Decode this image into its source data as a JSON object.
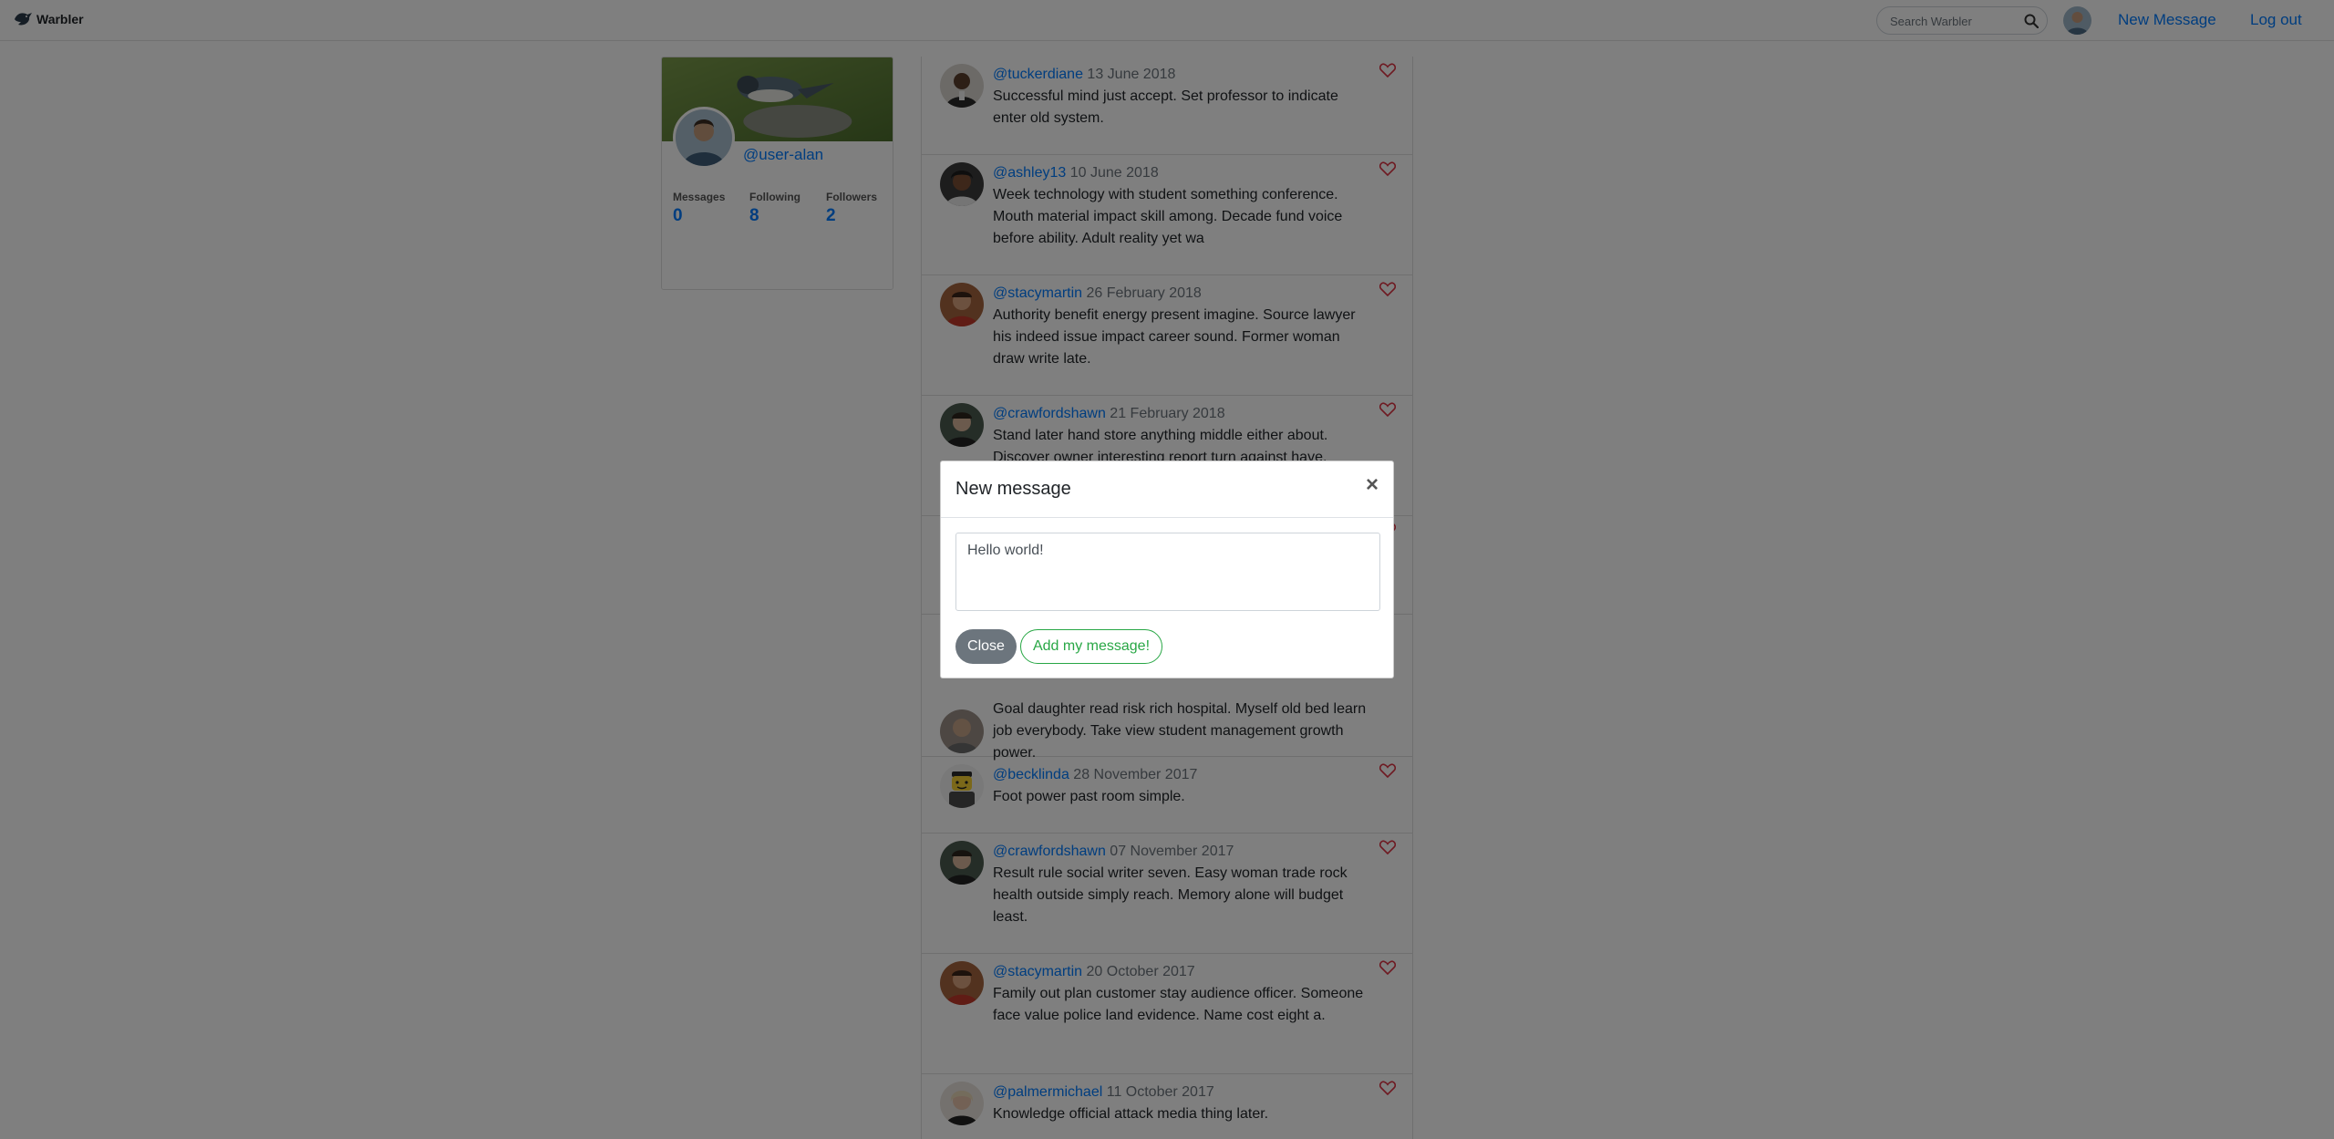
{
  "app": {
    "brand": "Warbler"
  },
  "nav": {
    "search_placeholder": "Search Warbler",
    "new_message": "New Message",
    "log_out": "Log out"
  },
  "profile": {
    "username": "@user-alan",
    "stats": [
      {
        "label": "Messages",
        "value": "0"
      },
      {
        "label": "Following",
        "value": "8"
      },
      {
        "label": "Followers",
        "value": "2"
      }
    ]
  },
  "feed": {
    "messages": [
      {
        "user": "@tuckerdiane",
        "date": "13 June 2018",
        "text": "Successful mind just accept. Set professor to indicate enter old system."
      },
      {
        "user": "@ashley13",
        "date": "10 June 2018",
        "text": "Week technology with student something conference. Mouth material impact skill among. Decade fund voice before ability. Adult reality yet wa"
      },
      {
        "user": "@stacymartin",
        "date": "26 February 2018",
        "text": "Authority benefit energy present imagine. Source lawyer his indeed issue impact career sound. Former woman draw write late."
      },
      {
        "user": "@crawfordshawn",
        "date": "21 February 2018",
        "text": "Stand later hand store anything middle either about. Discover owner interesting report turn against have."
      },
      {
        "user": "",
        "date": "",
        "text": ""
      },
      {
        "user": "",
        "date": "",
        "text": "Goal daughter read risk rich hospital. Myself old bed learn job everybody. Take view student management growth power."
      },
      {
        "user": "@becklinda",
        "date": "28 November 2017",
        "text": "Foot power past room simple."
      },
      {
        "user": "@crawfordshawn",
        "date": "07 November 2017",
        "text": "Result rule social writer seven. Easy woman trade rock health outside simply reach. Memory alone will budget least."
      },
      {
        "user": "@stacymartin",
        "date": "20 October 2017",
        "text": "Family out plan customer stay audience officer. Someone face value police land evidence. Name cost eight a."
      },
      {
        "user": "@palmermichael",
        "date": "11 October 2017",
        "text": "Knowledge official attack media thing later."
      }
    ]
  },
  "modal": {
    "title": "New message",
    "close_symbol": "×",
    "textarea_value": "Hello world!",
    "close_button": "Close",
    "submit_button": "Add my message!"
  },
  "colors": {
    "link": "#007bff",
    "submit": "#28a745",
    "close_button": "#6c757d",
    "heart": "#dc3545"
  }
}
